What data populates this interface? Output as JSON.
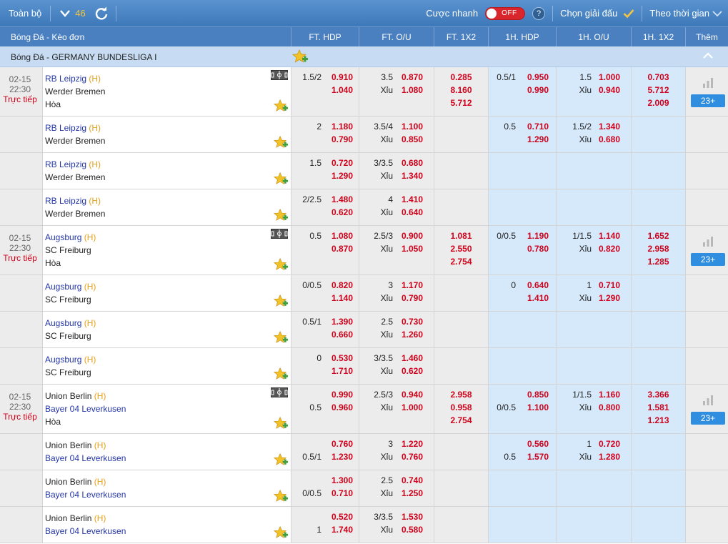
{
  "toolbar": {
    "all_label": "Toàn bộ",
    "count": "46",
    "quick_label": "Cược nhanh",
    "toggle_label": "OFF",
    "help": "?",
    "choose_label": "Chọn giải đấu",
    "by_time_label": "Theo thời gian"
  },
  "columns": {
    "main": "Bóng Đá - Kèo đơn",
    "ft_hdp": "FT. HDP",
    "ft_ou": "FT. O/U",
    "ft_1x2": "FT. 1X2",
    "h1_hdp": "1H. HDP",
    "h1_ou": "1H. O/U",
    "h1_1x2": "1H. 1X2",
    "more": "Thêm"
  },
  "league": {
    "name": "Bóng Đá - GERMANY BUNDESLIGA I"
  },
  "matches": [
    {
      "date": "02-15",
      "time": "22:30",
      "status": "Trực tiếp",
      "more_count": "23+",
      "home": "RB Leipzig",
      "away": "Werder Bremen",
      "home_mark": "(H)",
      "draw": "Hòa",
      "lines": [
        {
          "ft_hdp_h": "1.5/2",
          "ft_hdp_a": "",
          "ft_hdp_o1": "0.910",
          "ft_hdp_o2": "1.040",
          "ft_ou_line": "3.5",
          "ft_ou_u": "Xỉu",
          "ft_ou_o1": "0.870",
          "ft_ou_o2": "1.080",
          "ft_1x2": [
            "0.285",
            "8.160",
            "5.712"
          ],
          "h1_hdp_h": "0.5/1",
          "h1_hdp_a": "",
          "h1_hdp_o1": "0.950",
          "h1_hdp_o2": "0.990",
          "h1_ou_line": "1.5",
          "h1_ou_u": "Xỉu",
          "h1_ou_o1": "1.000",
          "h1_ou_o2": "0.940",
          "h1_1x2": [
            "0.703",
            "5.712",
            "2.009"
          ]
        },
        {
          "ft_hdp_h": "2",
          "ft_hdp_a": "",
          "ft_hdp_o1": "1.180",
          "ft_hdp_o2": "0.790",
          "ft_ou_line": "3.5/4",
          "ft_ou_u": "Xỉu",
          "ft_ou_o1": "1.100",
          "ft_ou_o2": "0.850",
          "h1_hdp_h": "0.5",
          "h1_hdp_a": "",
          "h1_hdp_o1": "0.710",
          "h1_hdp_o2": "1.290",
          "h1_ou_line": "1.5/2",
          "h1_ou_u": "Xỉu",
          "h1_ou_o1": "1.340",
          "h1_ou_o2": "0.680"
        },
        {
          "ft_hdp_h": "1.5",
          "ft_hdp_a": "",
          "ft_hdp_o1": "0.720",
          "ft_hdp_o2": "1.290",
          "ft_ou_line": "3/3.5",
          "ft_ou_u": "Xỉu",
          "ft_ou_o1": "0.680",
          "ft_ou_o2": "1.340"
        },
        {
          "ft_hdp_h": "2/2.5",
          "ft_hdp_a": "",
          "ft_hdp_o1": "1.480",
          "ft_hdp_o2": "0.620",
          "ft_ou_line": "4",
          "ft_ou_u": "Xỉu",
          "ft_ou_o1": "1.410",
          "ft_ou_o2": "0.640"
        }
      ]
    },
    {
      "date": "02-15",
      "time": "22:30",
      "status": "Trực tiếp",
      "more_count": "23+",
      "home": "Augsburg",
      "away": "SC Freiburg",
      "home_mark": "(H)",
      "draw": "Hòa",
      "lines": [
        {
          "ft_hdp_h": "0.5",
          "ft_hdp_a": "",
          "ft_hdp_o1": "1.080",
          "ft_hdp_o2": "0.870",
          "ft_ou_line": "2.5/3",
          "ft_ou_u": "Xỉu",
          "ft_ou_o1": "0.900",
          "ft_ou_o2": "1.050",
          "ft_1x2": [
            "1.081",
            "2.550",
            "2.754"
          ],
          "h1_hdp_h": "0/0.5",
          "h1_hdp_a": "",
          "h1_hdp_o1": "1.190",
          "h1_hdp_o2": "0.780",
          "h1_ou_line": "1/1.5",
          "h1_ou_u": "Xỉu",
          "h1_ou_o1": "1.140",
          "h1_ou_o2": "0.820",
          "h1_1x2": [
            "1.652",
            "2.958",
            "1.285"
          ]
        },
        {
          "ft_hdp_h": "0/0.5",
          "ft_hdp_a": "",
          "ft_hdp_o1": "0.820",
          "ft_hdp_o2": "1.140",
          "ft_ou_line": "3",
          "ft_ou_u": "Xỉu",
          "ft_ou_o1": "1.170",
          "ft_ou_o2": "0.790",
          "h1_hdp_h": "0",
          "h1_hdp_a": "",
          "h1_hdp_o1": "0.640",
          "h1_hdp_o2": "1.410",
          "h1_ou_line": "1",
          "h1_ou_u": "Xỉu",
          "h1_ou_o1": "0.710",
          "h1_ou_o2": "1.290"
        },
        {
          "ft_hdp_h": "0.5/1",
          "ft_hdp_a": "",
          "ft_hdp_o1": "1.390",
          "ft_hdp_o2": "0.660",
          "ft_ou_line": "2.5",
          "ft_ou_u": "Xỉu",
          "ft_ou_o1": "0.730",
          "ft_ou_o2": "1.260"
        },
        {
          "ft_hdp_h": "0",
          "ft_hdp_a": "",
          "ft_hdp_o1": "0.530",
          "ft_hdp_o2": "1.710",
          "ft_ou_line": "3/3.5",
          "ft_ou_u": "Xỉu",
          "ft_ou_o1": "1.460",
          "ft_ou_o2": "0.620"
        }
      ]
    },
    {
      "date": "02-15",
      "time": "22:30",
      "status": "Trực tiếp",
      "more_count": "23+",
      "home": "Union Berlin",
      "away": "Bayer 04 Leverkusen",
      "home_mark": "(H)",
      "draw": "Hòa",
      "lines": [
        {
          "ft_hdp_h": "",
          "ft_hdp_a": "0.5",
          "ft_hdp_o1": "0.990",
          "ft_hdp_o2": "0.960",
          "ft_ou_line": "2.5/3",
          "ft_ou_u": "Xỉu",
          "ft_ou_o1": "0.940",
          "ft_ou_o2": "1.000",
          "ft_1x2": [
            "2.958",
            "0.958",
            "2.754"
          ],
          "h1_hdp_h": "",
          "h1_hdp_a": "0/0.5",
          "h1_hdp_o1": "0.850",
          "h1_hdp_o2": "1.100",
          "h1_ou_line": "1/1.5",
          "h1_ou_u": "Xỉu",
          "h1_ou_o1": "1.160",
          "h1_ou_o2": "0.800",
          "h1_1x2": [
            "3.366",
            "1.581",
            "1.213"
          ]
        },
        {
          "ft_hdp_h": "",
          "ft_hdp_a": "0.5/1",
          "ft_hdp_o1": "0.760",
          "ft_hdp_o2": "1.230",
          "ft_ou_line": "3",
          "ft_ou_u": "Xỉu",
          "ft_ou_o1": "1.220",
          "ft_ou_o2": "0.760",
          "h1_hdp_h": "",
          "h1_hdp_a": "0.5",
          "h1_hdp_o1": "0.560",
          "h1_hdp_o2": "1.570",
          "h1_ou_line": "1",
          "h1_ou_u": "Xỉu",
          "h1_ou_o1": "0.720",
          "h1_ou_o2": "1.280"
        },
        {
          "ft_hdp_h": "",
          "ft_hdp_a": "0/0.5",
          "ft_hdp_o1": "1.300",
          "ft_hdp_o2": "0.710",
          "ft_ou_line": "2.5",
          "ft_ou_u": "Xỉu",
          "ft_ou_o1": "0.740",
          "ft_ou_o2": "1.250"
        },
        {
          "ft_hdp_h": "",
          "ft_hdp_a": "1",
          "ft_hdp_o1": "0.520",
          "ft_hdp_o2": "1.740",
          "ft_ou_line": "3/3.5",
          "ft_ou_u": "Xỉu",
          "ft_ou_o1": "1.530",
          "ft_ou_o2": "0.580"
        }
      ]
    }
  ],
  "colors": {
    "header_bg": "#4a7fc0",
    "odds_red": "#d0021b",
    "team_blue": "#2436a6",
    "first_half_bg": "#d6e9fb",
    "full_time_bg": "#ececec"
  },
  "icons": [
    "chevron-down-icon",
    "refresh-icon",
    "help-icon",
    "checkmark-icon",
    "star-plus-icon",
    "pitch-icon",
    "stats-bars-icon",
    "collapse-chevron-icon"
  ]
}
